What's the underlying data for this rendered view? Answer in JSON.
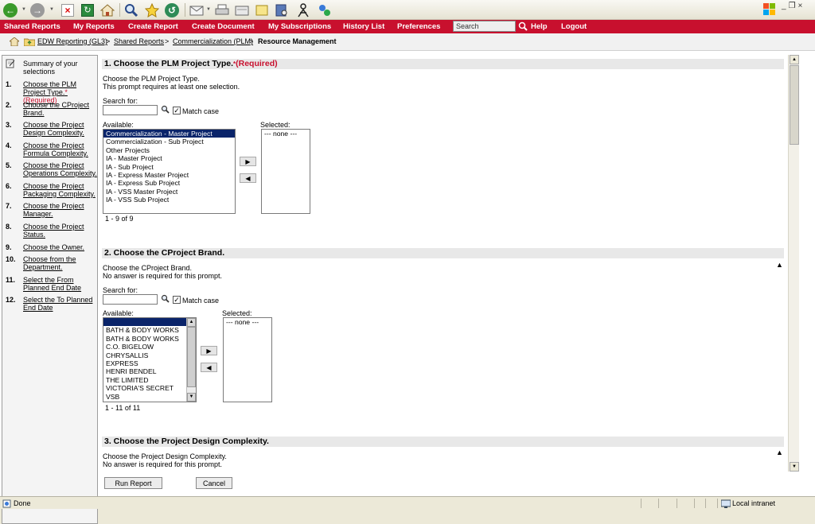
{
  "toolbar": {
    "icons": [
      "back-icon",
      "forward-icon",
      "stop-icon",
      "refresh-icon",
      "home-icon",
      "search-icon",
      "favorites-icon",
      "history-icon",
      "mail-icon",
      "print-icon",
      "edit-icon",
      "discuss-icon",
      "research-icon",
      "messenger-icon",
      "network-icon"
    ]
  },
  "nav": {
    "items": [
      "Shared Reports",
      "My Reports",
      "Create Report",
      "Create Document",
      "My Subscriptions",
      "History List",
      "Preferences"
    ],
    "search_value": "Search",
    "help": "Help",
    "logout": "Logout",
    "accent": "#c8102e"
  },
  "breadcrumb": {
    "items": [
      "EDW Reporting (GL3)",
      "Shared Reports",
      "Commercialization (PLM)"
    ],
    "separator": ">",
    "current": "Resource Management"
  },
  "sidebar": {
    "summary": "Summary of your selections",
    "items": [
      {
        "num": "1.",
        "label": "Choose the PLM Project Type.",
        "required": "(Required)"
      },
      {
        "num": "2.",
        "label": "Choose the CProject Brand."
      },
      {
        "num": "3.",
        "label": "Choose the Project Design Complexity."
      },
      {
        "num": "4.",
        "label": "Choose the Project Formula Complexity."
      },
      {
        "num": "5.",
        "label": "Choose the Project Operations Complexity."
      },
      {
        "num": "6.",
        "label": "Choose the Project Packaging Complexity."
      },
      {
        "num": "7.",
        "label": "Choose the Project Manager."
      },
      {
        "num": "8.",
        "label": "Choose the Project Status."
      },
      {
        "num": "9.",
        "label": "Choose the Owner."
      },
      {
        "num": "10.",
        "label": "Choose from the Department."
      },
      {
        "num": "11.",
        "label": "Select the From Planned End Date"
      },
      {
        "num": "12.",
        "label": "Select the To Planned End Date"
      }
    ]
  },
  "sections": {
    "s1": {
      "title": "1.  Choose the PLM Project Type.",
      "required_star": "*",
      "required": "(Required)",
      "desc1": "Choose the PLM Project Type.",
      "desc2": "This prompt requires at least one selection.",
      "search_label": "Search for:",
      "match_case": "Match case",
      "available_label": "Available:",
      "selected_label": "Selected:",
      "available": [
        "Commercialization - Master Project",
        "Commercialization - Sub Project",
        "Other Projects",
        "IA - Master Project",
        "IA - Sub Project",
        "IA - Express Master Project",
        "IA - Express Sub Project",
        "IA - VSS Master Project",
        "IA - VSS Sub Project"
      ],
      "selected": [
        "--- none ---"
      ],
      "count": "1 - 9 of 9"
    },
    "s2": {
      "title": "2.  Choose the CProject Brand.",
      "desc1": "Choose the CProject Brand.",
      "desc2": "No answer is required for this prompt.",
      "search_label": "Search for:",
      "match_case": "Match case",
      "available_label": "Available:",
      "selected_label": "Selected:",
      "available": [
        "",
        "BATH & BODY WORKS",
        "BATH & BODY WORKS",
        "C.O. BIGELOW",
        "CHRYSALLIS",
        "EXPRESS",
        "HENRI BENDEL",
        "THE LIMITED",
        "VICTORIA'S SECRET",
        "VSB"
      ],
      "selected": [
        "--- none ---"
      ],
      "count": "1 - 11 of 11"
    },
    "s3": {
      "title": "3.  Choose the Project Design Complexity.",
      "desc1": "Choose the Project Design Complexity.",
      "desc2": "No answer is required for this prompt."
    }
  },
  "buttons": {
    "run": "Run Report",
    "cancel": "Cancel"
  },
  "status": {
    "text": "Done",
    "zone": "Local intranet"
  }
}
